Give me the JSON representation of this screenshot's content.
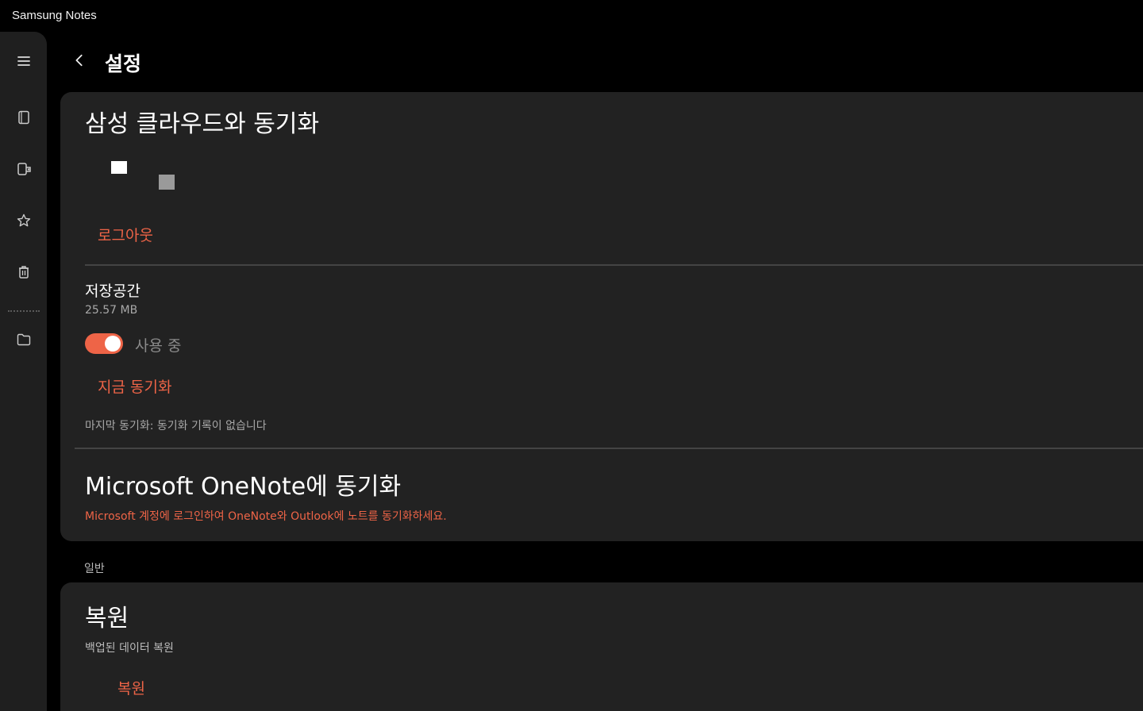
{
  "window": {
    "title": "Samsung Notes"
  },
  "sidebar": {
    "icons": [
      {
        "name": "menu-icon"
      },
      {
        "name": "notes-icon"
      },
      {
        "name": "shared-notes-icon"
      },
      {
        "name": "favorites-icon"
      },
      {
        "name": "trash-icon"
      },
      {
        "name": "folder-icon"
      }
    ]
  },
  "header": {
    "title": "설정"
  },
  "samsung_cloud": {
    "title": "삼성 클라우드와 동기화",
    "logout": "로그아웃",
    "storage_label": "저장공간",
    "storage_value": "25.57 MB",
    "toggle_label": "사용 중",
    "toggle_on": true,
    "sync_now": "지금 동기화",
    "last_sync": "마지막 동기화: 동기화 기록이 없습니다"
  },
  "onenote": {
    "title": "Microsoft OneNote에 동기화",
    "description": "Microsoft 계정에 로그인하여 OneNote와 Outlook에 노트를 동기화하세요."
  },
  "general": {
    "section_label": "일반",
    "restore_title": "복원",
    "restore_desc": "백업된 데이터 복원",
    "restore_button": "복원"
  },
  "colors": {
    "accent": "#ee6447",
    "card": "#222222",
    "sidebar": "#1f1f1f"
  }
}
